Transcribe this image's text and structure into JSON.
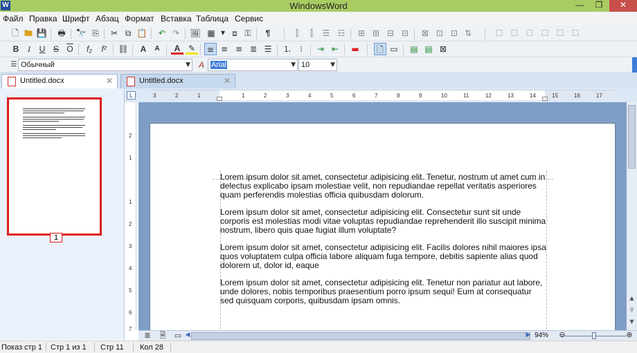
{
  "window": {
    "title": "WindowsWord",
    "app_icon": "W",
    "minimize": "—",
    "restore": "❐",
    "close": "✕"
  },
  "menu": [
    "Файл",
    "Правка",
    "Шрифт",
    "Абзац",
    "Формат",
    "Вставка",
    "Таблица",
    "Сервис"
  ],
  "toolbar": {
    "style_value": "Обычный",
    "font_value": "Arial",
    "size_value": "10",
    "bold": "B",
    "italic": "I",
    "underline": "U",
    "strike": "S",
    "overline": "O",
    "subscript": "f₂",
    "superscript": "f²",
    "grow_font": "A",
    "shrink_font": "A",
    "pilcrow": "¶",
    "font_color": "A"
  },
  "tabs": [
    {
      "label": "Untitled.docx",
      "close": "✕"
    },
    {
      "label": "Untitled.docx",
      "close": "✕"
    }
  ],
  "thumbnail": {
    "page_number": "1"
  },
  "ruler": {
    "h_ticks": [
      "3",
      "2",
      "1",
      "",
      "1",
      "2",
      "3",
      "4",
      "5",
      "6",
      "7",
      "8",
      "9",
      "10",
      "11",
      "12",
      "13",
      "14",
      "15",
      "16",
      "17"
    ],
    "v_ticks": [
      "2",
      "1",
      "",
      "1",
      "2",
      "3",
      "4",
      "5",
      "6",
      "7"
    ]
  },
  "document": {
    "paragraphs": [
      "Lorem ipsum dolor sit amet, consectetur adipisicing elit. Tenetur, nostrum ut amet cum in delectus explicabo ipsam molestiae velit, non repudiandae repellat veritatis asperiores quam perferendis molestias officia quibusdam dolorum.",
      "Lorem ipsum dolor sit amet, consectetur adipisicing elit. Consectetur sunt sit unde corporis est molestias modi vitae voluptas repudiandae reprehenderit illo suscipit minima nostrum, libero quis quae fugiat illum voluptate?",
      "Lorem ipsum dolor sit amet, consectetur adipisicing elit. Facilis dolores nihil maiores ipsa quos voluptatem culpa officia labore aliquam fuga tempore, debitis sapiente alias quod dolorem ut, dolor id, eaque",
      "Lorem ipsum dolor sit amet, consectetur adipisicing elit. Tenetur non pariatur aut labore, unde dolores, nobis temporibus praesentium porro ipsum sequi! Eum at consequatur sed quisquam corporis, quibusdam ipsam omnis."
    ]
  },
  "zoom": "94%",
  "status": {
    "view": "Показ стр 1",
    "page": "Стр 1 из 1",
    "line": "Стр 11",
    "col": "Кол 28"
  },
  "colors": {
    "titlebar": "#a9cc62",
    "close": "#c7504a",
    "canvas": "#7f9dc6",
    "thumb_border": "#e01a1a"
  }
}
